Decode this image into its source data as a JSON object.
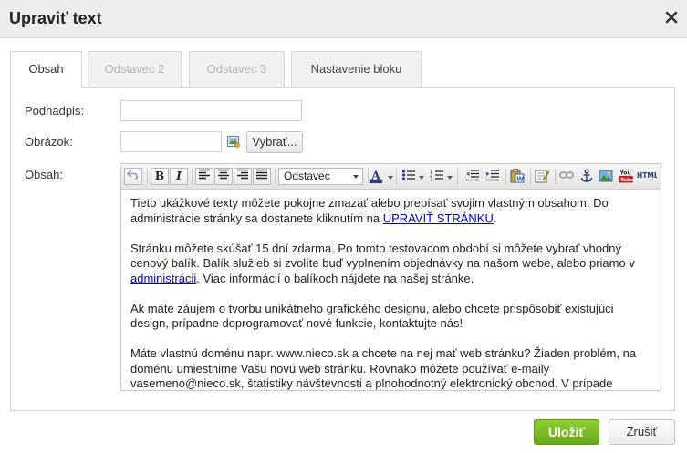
{
  "dialog": {
    "title": "Upraviť text"
  },
  "tabs": [
    {
      "label": "Obsah",
      "state": "active"
    },
    {
      "label": "Odstavec 2",
      "state": "disabled"
    },
    {
      "label": "Odstavec 3",
      "state": "disabled"
    },
    {
      "label": "Nastavenie bloku",
      "state": "enabled"
    }
  ],
  "form": {
    "subtitle_label": "Podnadpis:",
    "subtitle_value": "",
    "image_label": "Obrázok:",
    "image_value": "",
    "browse_label": "Vybrať...",
    "content_label": "Obsah:"
  },
  "editor": {
    "toolbar": {
      "undo_icon": "undo-icon",
      "bold": "B",
      "italic": "I",
      "format_select_value": "Odstavec",
      "icons": [
        "align-left-icon",
        "align-center-icon",
        "align-right-icon",
        "align-justify-icon",
        "font-color-icon",
        "bullet-list-icon",
        "numbered-list-icon",
        "outdent-icon",
        "indent-icon",
        "paste-word-icon",
        "edit-source-icon",
        "link-icon",
        "anchor-icon",
        "image-icon",
        "youtube-icon",
        "html-icon"
      ],
      "youtube_text": "You",
      "html_text": "HTML"
    },
    "paragraphs": {
      "p1_before_link": "Tieto ukážkové texty môžete pokojne zmazať alebo prepísať svojim vlastným obsahom. Do administrácie stránky sa dostanete kliknutím na ",
      "p1_link": "UPRAVIŤ STRÁNKU",
      "p1_after_link": ".",
      "p2_before_link": "Stránku môžete skúšať 15 dní zdarma. Po tomto testovacom období si môžete vybrať vhodný cenový balík. Balík služieb si zvolíte buď vyplnením objednávky na našom webe, alebo priamo v ",
      "p2_link": "administrácii",
      "p2_after_link": ". Viac informácií o balíkoch nájdete na našej stránke.",
      "p3": "Ak máte záujem o tvorbu unikátneho grafického designu, alebo chcete prispôsobiť existujúci design, prípadne doprogramovať nové funkcie, kontaktujte nás!",
      "p4": "Máte vlastnú doménu napr. www.nieco.sk a chcete na nej mať web stránku? Žiaden problém, na doménu umiestnime Vašu novú web stránku. Rovnako môžete používať e-maily vasemeno@nieco.sk, štatistiky návštevnosti a plnohodnotný elektronický obchod. V prípade akýchkoľvek otázok nás neváhajte kontaktovať!"
    }
  },
  "footer": {
    "save_label": "Uložiť",
    "cancel_label": "Zrušiť"
  },
  "colors": {
    "save_button": "#7cbd26",
    "link": "#0000cc",
    "titlebar": "#ececec"
  }
}
